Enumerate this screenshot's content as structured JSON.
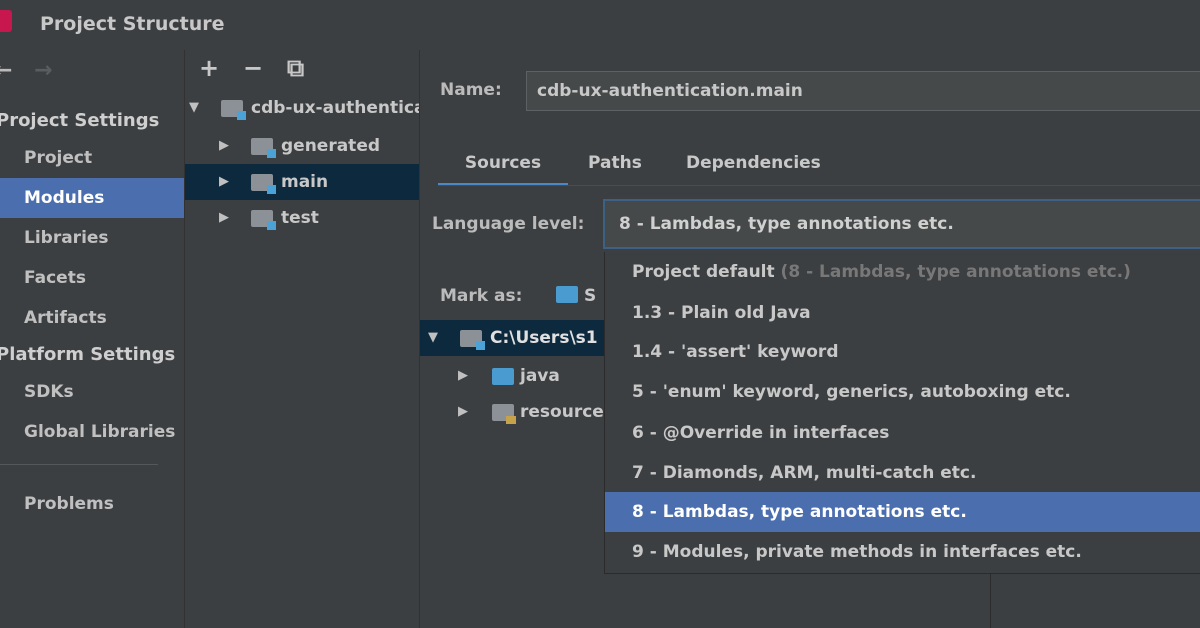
{
  "window": {
    "title": "Project Structure"
  },
  "nav": {
    "back_icon": "←",
    "forward_icon": "→"
  },
  "sidebar": {
    "project_settings_header": "Project Settings",
    "project_items": [
      {
        "label": "Project"
      },
      {
        "label": "Modules"
      },
      {
        "label": "Libraries"
      },
      {
        "label": "Facets"
      },
      {
        "label": "Artifacts"
      }
    ],
    "platform_settings_header": "Platform Settings",
    "platform_items": [
      {
        "label": "SDKs"
      },
      {
        "label": "Global Libraries"
      }
    ],
    "problems_label": "Problems"
  },
  "tree_toolbar": {
    "add_icon": "+",
    "remove_icon": "−",
    "copy_icon": "⧉"
  },
  "module_tree": {
    "root": "cdb-ux-authenticatio",
    "children": [
      {
        "label": "generated"
      },
      {
        "label": "main"
      },
      {
        "label": "test"
      }
    ]
  },
  "main": {
    "name_label": "Name:",
    "name_value": "cdb-ux-authentication.main",
    "tabs": [
      {
        "label": "Sources"
      },
      {
        "label": "Paths"
      },
      {
        "label": "Dependencies"
      }
    ],
    "language_level_label": "Language level:",
    "language_level_value": "8 - Lambdas, type annotations etc.",
    "mark_as_label": "Mark as:",
    "mark_as_partial": "S",
    "content_root": "C:\\Users\\s1",
    "content_children": [
      {
        "label": "java"
      },
      {
        "label": "resources"
      }
    ]
  },
  "dropdown": {
    "project_default_label": "Project default",
    "project_default_hint": "(8 - Lambdas, type annotations etc.)",
    "options": [
      {
        "label": "1.3 - Plain old Java"
      },
      {
        "label": "1.4 - 'assert' keyword"
      },
      {
        "label": "5 - 'enum' keyword, generics, autoboxing etc."
      },
      {
        "label": "6 - @Override in interfaces"
      },
      {
        "label": "7 - Diamonds, ARM, multi-catch etc."
      },
      {
        "label": "8 - Lambdas, type annotations etc."
      },
      {
        "label": "9 - Modules, private methods in interfaces etc."
      }
    ],
    "selected_index": 5
  },
  "colors": {
    "background": "#3c3f41",
    "selection": "#4b6eaf",
    "tree_selection": "#0d293e",
    "focus_border": "#3d6185"
  }
}
